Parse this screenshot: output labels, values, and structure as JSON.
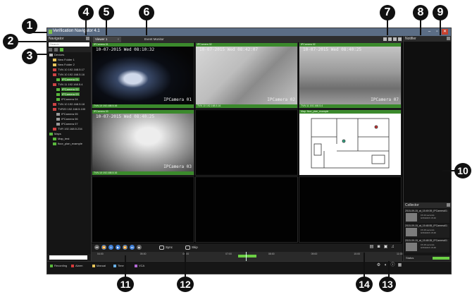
{
  "window": {
    "title": "Verification Navigator 4.1",
    "controls": [
      "–",
      "▫",
      "✕"
    ]
  },
  "navigator": {
    "title": "Navigator",
    "search_placeholder": "Search",
    "tree": [
      {
        "label": "Devices",
        "indent": 0,
        "icon_color": "#bbbbbb"
      },
      {
        "label": "New Folder 1",
        "indent": 1,
        "icon_color": "#e6c35a"
      },
      {
        "label": "New Folder 2",
        "indent": 1,
        "icon_color": "#e6c35a"
      },
      {
        "label": "TVN 10 192.168.5.17",
        "indent": 1,
        "icon_color": "#cc4444"
      },
      {
        "label": "TVN 10 192.168.5.16",
        "indent": 1,
        "icon_color": "#cc4444"
      },
      {
        "label": "IPCamera 01",
        "indent": 2,
        "icon_color": "#59b83c",
        "selected": true
      },
      {
        "label": "TVN 11 192.168.5.4",
        "indent": 1,
        "icon_color": "#cc4444"
      },
      {
        "label": "IPCamera 02",
        "indent": 2,
        "icon_color": "#59b83c",
        "selected": true
      },
      {
        "label": "IPCamera 03",
        "indent": 2,
        "icon_color": "#59b83c",
        "selected": true
      },
      {
        "label": "IPCamera 04",
        "indent": 2,
        "icon_color": "#59b83c"
      },
      {
        "label": "TVN 10 192.168.5.18",
        "indent": 1,
        "icon_color": "#cc4444"
      },
      {
        "label": "TVR20 192.168.5.100",
        "indent": 1,
        "icon_color": "#cc4444"
      },
      {
        "label": "IPCamera 05",
        "indent": 2,
        "icon_color": "#999999"
      },
      {
        "label": "IPCamera 06",
        "indent": 2,
        "icon_color": "#999999"
      },
      {
        "label": "IPCamera 07",
        "indent": 2,
        "icon_color": "#999999"
      },
      {
        "label": "TVR 192.168.5.234",
        "indent": 1,
        "icon_color": "#cc4444"
      },
      {
        "label": "Maps",
        "indent": 0,
        "icon_color": "#59b83c"
      },
      {
        "label": "Map_test",
        "indent": 1,
        "icon_color": "#59b83c"
      },
      {
        "label": "floor_plan_example",
        "indent": 1,
        "icon_color": "#59b83c"
      }
    ]
  },
  "tabs": [
    {
      "label": "Viewer 1",
      "active": true
    },
    {
      "label": "Event Monitor",
      "active": false
    }
  ],
  "cells": [
    {
      "header": "IPCamera 01",
      "osd": "10-07-2015 Wed 08:10:32",
      "cam": "IPCamera 01",
      "footer": "TVN 10 192.168.5.16",
      "scene": "light"
    },
    {
      "header": "IPCamera 02",
      "osd": "10-07-2015 Wed 08:42:07",
      "cam": "IPCamera 02",
      "footer": "TVN 10 192.168.5.16",
      "scene": "wires"
    },
    {
      "header": "IPCamera 02",
      "osd": "10-07-2015 Wed 08:40:25",
      "cam": "IPCamera 07",
      "footer": "TVN 11 192.168.5.4",
      "scene": "room"
    },
    {
      "header": "IPCamera 03",
      "osd": "10-07-2015 Wed 08:40:25",
      "cam": "IPCamera 03",
      "footer": "TVN 10 192.168.5.16",
      "scene": "ceiling"
    },
    {
      "header": "",
      "osd": "",
      "cam": "",
      "footer": "",
      "scene": "empty"
    },
    {
      "header": "Map: floor_plan_example",
      "osd": "",
      "cam": "",
      "footer": "",
      "scene": "map"
    },
    {
      "header": "",
      "osd": "",
      "cam": "",
      "footer": "",
      "scene": "empty"
    },
    {
      "header": "",
      "osd": "",
      "cam": "",
      "footer": "",
      "scene": "empty"
    },
    {
      "header": "",
      "osd": "",
      "cam": "",
      "footer": "",
      "scene": "empty"
    }
  ],
  "controls": {
    "playback": [
      "⏮",
      "⏪",
      "⏸",
      "▶",
      "⏩",
      "⏭",
      "■"
    ],
    "sync_label": "Sync",
    "skip_label": "Skip"
  },
  "timeline": {
    "ticks": [
      "04:00",
      "05:00",
      "06:00",
      "07:00",
      "08:00",
      "09:00",
      "10:00",
      "11:00"
    ]
  },
  "statusbar": {
    "legend": [
      {
        "label": "Recording",
        "color": "#59b83c"
      },
      {
        "label": "Alarm",
        "color": "#d83a3a"
      },
      {
        "label": "Manual",
        "color": "#e6c35a"
      },
      {
        "label": "Time",
        "color": "#6ab0e6"
      },
      {
        "label": "VCA",
        "color": "#b36ad6"
      }
    ]
  },
  "notifier": {
    "title": "Notifier"
  },
  "collector": {
    "title": "Collector",
    "items": [
      {
        "caption": "2015-09-15_at_15:49:39_IPCamera01",
        "meta1": "15:49 seconds",
        "meta2": "9/15/2015 15:49"
      },
      {
        "caption": "2015-09-15_at_15:48:55_IPCamera01",
        "meta1": "15:48 seconds",
        "meta2": "9/15/2015 15:48"
      },
      {
        "caption": "2015-09-15_at_15:48:35_IPCamera01",
        "meta1": "15:48 seconds",
        "meta2": "9/15/2015 15:48"
      }
    ],
    "footer_label": "Status"
  },
  "callouts": [
    "1",
    "2",
    "3",
    "4",
    "5",
    "6",
    "7",
    "8",
    "9",
    "10",
    "11",
    "12",
    "13",
    "14"
  ],
  "colors": {
    "accent_green": "#3b8a2c",
    "button_blue": "#3f7fd6",
    "timeline_green": "#6ccf45"
  }
}
